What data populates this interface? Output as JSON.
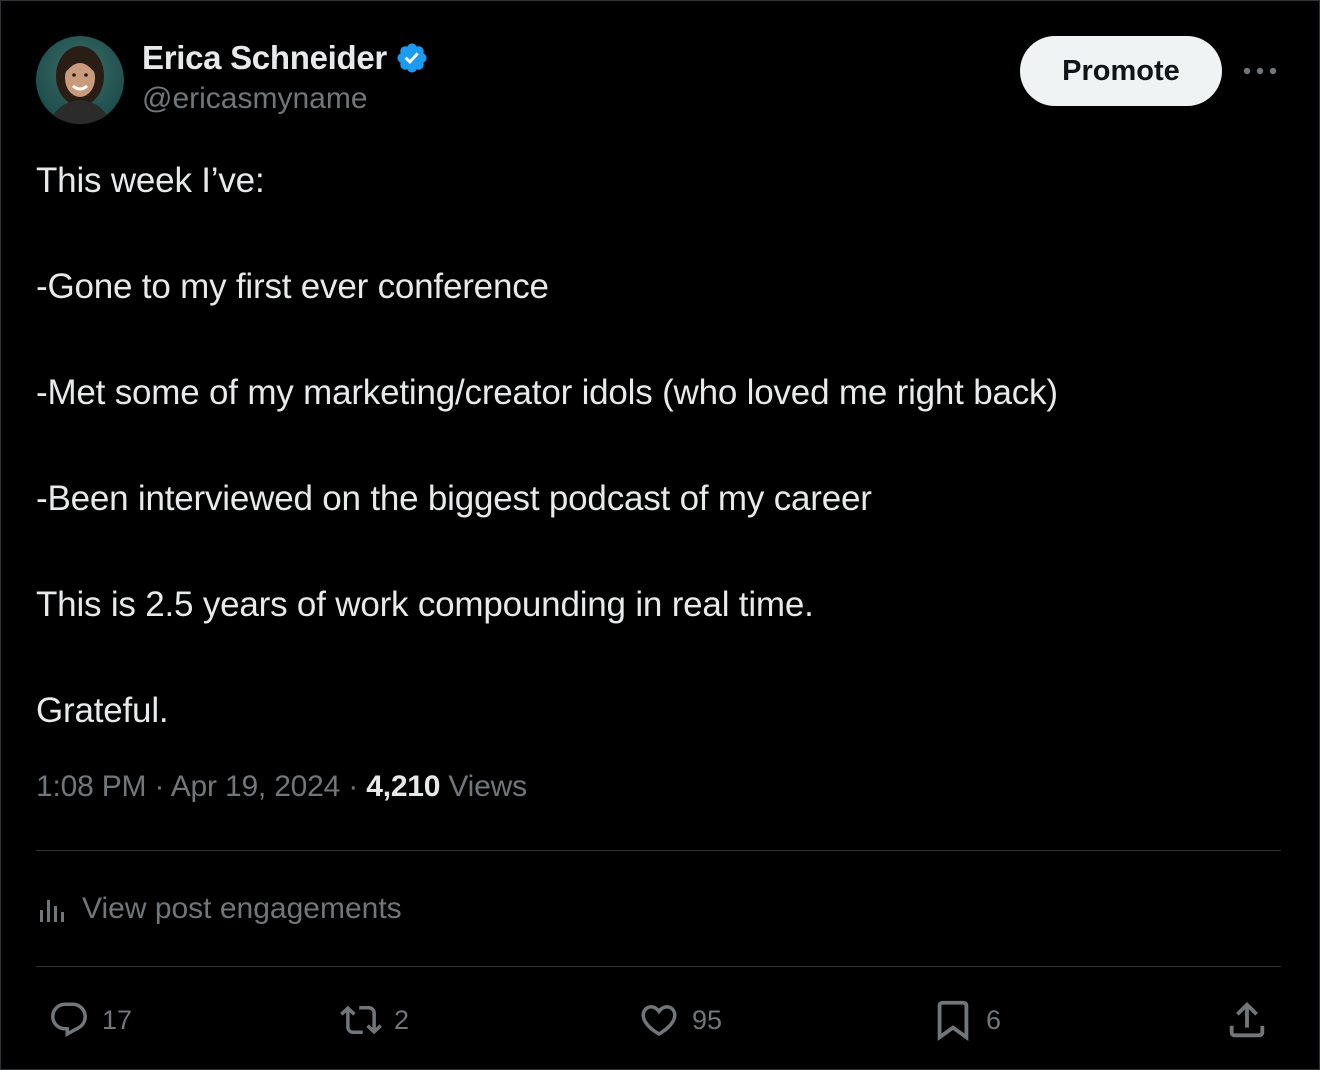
{
  "author": {
    "name": "Erica Schneider",
    "handle": "@ericasmyname"
  },
  "promote_label": "Promote",
  "tweet_lines": [
    "This week I’ve:",
    "-Gone to my first ever conference",
    "-Met some of my marketing/creator idols (who loved me right back)",
    "-Been interviewed on the biggest podcast of my career",
    "This is 2.5 years of work compounding in real time.",
    "Grateful."
  ],
  "meta": {
    "time": "1:08 PM",
    "sep1": " · ",
    "date": "Apr 19, 2024",
    "sep2": " · ",
    "views_count": "4,210",
    "views_label": " Views"
  },
  "engagements_label": "View post engagements",
  "actions": {
    "replies": "17",
    "reposts": "2",
    "likes": "95",
    "bookmarks": "6"
  },
  "colors": {
    "background": "#000000",
    "text": "#e7e9ea",
    "secondary": "#71767b",
    "verified": "#1d9bf0",
    "divider": "#2f3336"
  }
}
